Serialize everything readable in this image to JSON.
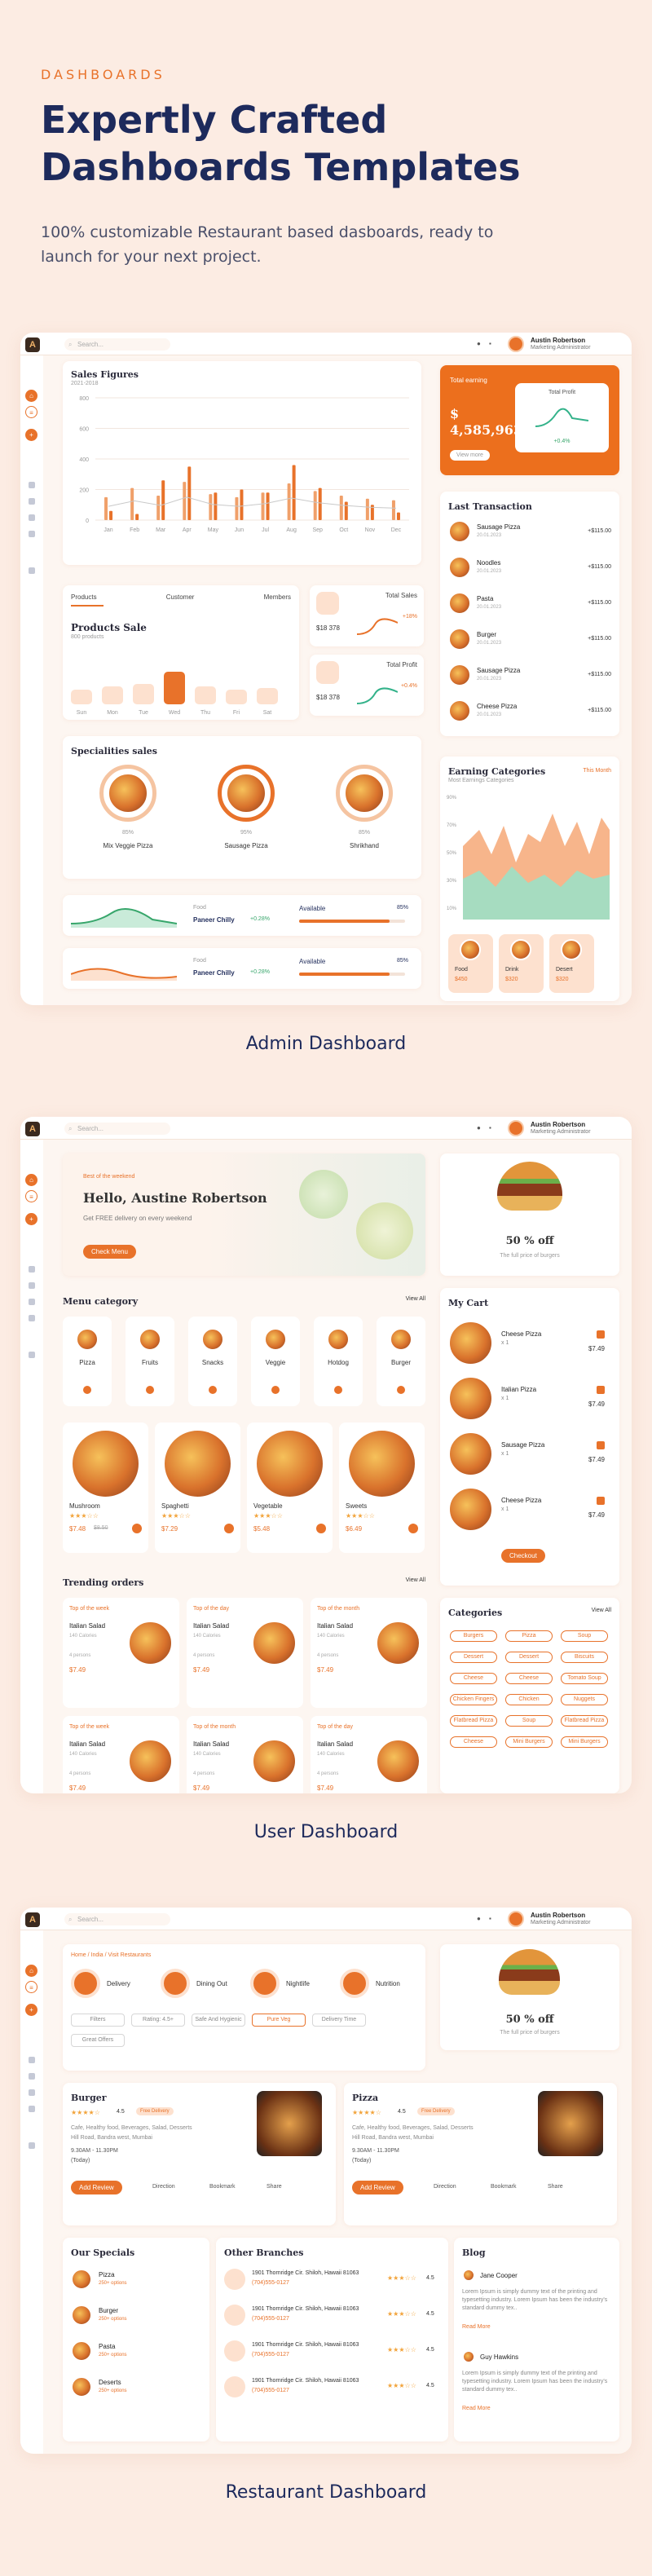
{
  "hero": {
    "kicker": "DASHBOARDS",
    "title_line1": "Expertly Crafted",
    "title_line2": "Dashboards Templates",
    "lead": "100% customizable Restaurant based dasboards, ready to launch for your next project."
  },
  "captions": {
    "admin": "Admin Dashboard",
    "user": "User Dashboard",
    "restaurant": "Restaurant Dashboard"
  },
  "common": {
    "search_placeholder": "Search...",
    "user_name": "Austin Robertson",
    "user_role": "Marketing Administrator"
  },
  "admin": {
    "sales_title": "Sales Figures",
    "sales_sub": "2021-2018",
    "chart_data": {
      "type": "bar",
      "categories": [
        "Jan",
        "Feb",
        "Mar",
        "Apr",
        "May",
        "Jun",
        "Jul",
        "Aug",
        "Sep",
        "Oct",
        "Nov",
        "Dec"
      ],
      "series": [
        {
          "values": [
            150,
            210,
            160,
            250,
            170,
            150,
            180,
            240,
            190,
            160,
            140,
            130
          ]
        },
        {
          "values": [
            60,
            40,
            260,
            350,
            180,
            200,
            180,
            360,
            210,
            120,
            100,
            50
          ]
        }
      ],
      "y_ticks": [
        "0",
        "200",
        "400",
        "600",
        "800"
      ],
      "ylim": [
        0,
        800
      ]
    },
    "total_earning": {
      "label": "Total earning",
      "value": "$ 4,585,963",
      "btn": "View more",
      "profit_label": "Total Profit",
      "profit_change": "+0.4%"
    },
    "tabs": [
      "Products",
      "Customer",
      "Members"
    ],
    "products_sale": {
      "title": "Products Sale",
      "sub": "800 products",
      "days": [
        "Sun",
        "Mon",
        "Tue",
        "Wed",
        "Thu",
        "Fri",
        "Sat"
      ],
      "values": [
        20,
        25,
        28,
        45,
        25,
        20,
        22
      ]
    },
    "total_sales": {
      "label": "Total Sales",
      "value": "$18 378",
      "change": "+18%"
    },
    "total_profit": {
      "label": "Total Profit",
      "value": "$18 378",
      "change": "+0.4%"
    },
    "specialities": {
      "title": "Specialities sales",
      "items": [
        {
          "pct": "85%",
          "name": "Mix Veggie Pizza"
        },
        {
          "pct": "95%",
          "name": "Sausage Pizza"
        },
        {
          "pct": "85%",
          "name": "Shrikhand"
        }
      ]
    },
    "food_rows": [
      {
        "label": "Food",
        "name": "Paneer Chilly",
        "change": "+0.28%",
        "avail": "Available",
        "pct": "85%"
      },
      {
        "label": "Food",
        "name": "Paneer Chilly",
        "change": "+0.28%",
        "avail": "Available",
        "pct": "85%"
      }
    ],
    "last_transaction": {
      "title": "Last Transaction",
      "items": [
        {
          "name": "Sausage Pizza",
          "date": "20.01.2023",
          "amount": "+$115.00"
        },
        {
          "name": "Noodles",
          "date": "20.01.2023",
          "amount": "+$115.00"
        },
        {
          "name": "Pasta",
          "date": "20.01.2023",
          "amount": "+$115.00"
        },
        {
          "name": "Burger",
          "date": "20.01.2023",
          "amount": "+$115.00"
        },
        {
          "name": "Sausage Pizza",
          "date": "20.01.2023",
          "amount": "+$115.00"
        },
        {
          "name": "Cheese Pizza",
          "date": "20.01.2023",
          "amount": "+$115.00"
        }
      ]
    },
    "earning_categories": {
      "title": "Earning Categories",
      "sub": "Most Earnings Categories",
      "filter": "This Month",
      "y_ticks": [
        "90%",
        "70%",
        "50%",
        "30%",
        "10%"
      ],
      "cats": [
        {
          "name": "Food",
          "value": "$450"
        },
        {
          "name": "Drink",
          "value": "$320"
        },
        {
          "name": "Desert",
          "value": "$320"
        }
      ]
    }
  },
  "user": {
    "banner": {
      "tag": "Best of the weekend",
      "title": "Hello, Austine Robertson",
      "sub": "Get FREE delivery on every weekend",
      "btn": "Check Menu"
    },
    "promo": {
      "title": "50 % off",
      "sub": "The full price of burgers"
    },
    "menu": {
      "title": "Menu category",
      "view": "View All",
      "items": [
        "Pizza",
        "Fruits",
        "Snacks",
        "Veggie",
        "Hotdog",
        "Burger"
      ]
    },
    "dishes": [
      {
        "name": "Mushroom",
        "price": "$7.48",
        "old": "$8.50"
      },
      {
        "name": "Spaghetti",
        "price": "$7.29"
      },
      {
        "name": "Vegetable",
        "price": "$5.48"
      },
      {
        "name": "Sweets",
        "price": "$6.49"
      }
    ],
    "cart": {
      "title": "My Cart",
      "items": [
        {
          "name": "Cheese Pizza",
          "qty": "x 1",
          "price": "$7.49"
        },
        {
          "name": "Italian Pizza",
          "qty": "x 1",
          "price": "$7.49"
        },
        {
          "name": "Sausage Pizza",
          "qty": "x 1",
          "price": "$7.49"
        },
        {
          "name": "Cheese Pizza",
          "qty": "x 1",
          "price": "$7.49"
        }
      ],
      "btn": "Checkout"
    },
    "trending": {
      "title": "Trending orders",
      "view": "View All",
      "items": [
        {
          "tag": "Top of the week",
          "name": "Italian Salad",
          "cal": "140 Calories",
          "persons": "4 persons",
          "price": "$7.49"
        },
        {
          "tag": "Top of the day",
          "name": "Italian Salad",
          "cal": "140 Calories",
          "persons": "4 persons",
          "price": "$7.49"
        },
        {
          "tag": "Top of the month",
          "name": "Italian Salad",
          "cal": "140 Calories",
          "persons": "4 persons",
          "price": "$7.49"
        },
        {
          "tag": "Top of the week",
          "name": "Italian Salad",
          "cal": "140 Calories",
          "persons": "4 persons",
          "price": "$7.49"
        },
        {
          "tag": "Top of the month",
          "name": "Italian Salad",
          "cal": "140 Calories",
          "persons": "4 persons",
          "price": "$7.49"
        },
        {
          "tag": "Top of the day",
          "name": "Italian Salad",
          "cal": "140 Calories",
          "persons": "4 persons",
          "price": "$7.49"
        }
      ]
    },
    "categories": {
      "title": "Categories",
      "view": "View All",
      "items": [
        "Burgers",
        "Pizza",
        "Soup",
        "Dessert",
        "Dessert",
        "Biscuits",
        "Cheese",
        "Cheese",
        "Tomato Soup",
        "Chicken Fingers",
        "Chicken",
        "Nuggets",
        "Flatbread Pizza",
        "Soup",
        "Flatbread Pizza",
        "Cheese",
        "Mini Burgers",
        "Mini Burgers"
      ]
    }
  },
  "restaurant": {
    "breadcrumb": "Home / India / Visit Restaurants",
    "services": [
      "Delivery",
      "Dining Out",
      "Nightlife",
      "Nutrition"
    ],
    "filters": [
      "Filters",
      "Rating: 4.5+",
      "Safe And Hygienic",
      "Pure Veg",
      "Delivery Time",
      "Great Offers"
    ],
    "promo": {
      "title": "50 % off",
      "sub": "The full price of burgers"
    },
    "places": [
      {
        "title": "Burger",
        "rating": "4.5",
        "badge": "Free Delivery",
        "desc": "Cafe, Healthy food, Beverages, Salad, Desserts",
        "addr": "Hill Road, Bandra west, Mumbai",
        "time": "9.30AM - 11.30PM",
        "day": "(Today)",
        "btn": "Add Review",
        "actions": [
          "Direction",
          "Bookmark",
          "Share"
        ]
      },
      {
        "title": "Pizza",
        "rating": "4.5",
        "badge": "Free Delivery",
        "desc": "Cafe, Healthy food, Beverages, Salad, Desserts",
        "addr": "Hill Road, Bandra west, Mumbai",
        "time": "9.30AM - 11.30PM",
        "day": "(Today)",
        "btn": "Add Review",
        "actions": [
          "Direction",
          "Bookmark",
          "Share"
        ]
      }
    ],
    "specials": {
      "title": "Our Specials",
      "items": [
        {
          "name": "Pizza",
          "opts": "250+ options"
        },
        {
          "name": "Burger",
          "opts": "250+ options"
        },
        {
          "name": "Pasta",
          "opts": "250+ options"
        },
        {
          "name": "Deserts",
          "opts": "250+ options"
        }
      ]
    },
    "branches": {
      "title": "Other Branches",
      "items": [
        {
          "addr": "1901 Thornridge Cir. Shiloh, Hawaii 81063",
          "phone": "(704)555-0127",
          "rating": "4.5"
        },
        {
          "addr": "1901 Thornridge Cir. Shiloh, Hawaii 81063",
          "phone": "(704)555-0127",
          "rating": "4.5"
        },
        {
          "addr": "1901 Thornridge Cir. Shiloh, Hawaii 81063",
          "phone": "(704)555-0127",
          "rating": "4.5"
        },
        {
          "addr": "1901 Thornridge Cir. Shiloh, Hawaii 81063",
          "phone": "(704)555-0127",
          "rating": "4.5"
        }
      ]
    },
    "blog": {
      "title": "Blog",
      "items": [
        {
          "author": "Jane Cooper",
          "text": "Lorem Ipsum is simply dummy text of the printing and typesetting industry. Lorem Ipsum has been the industry's standard dummy tex..",
          "more": "Read More"
        },
        {
          "author": "Guy Hawkins",
          "text": "Lorem Ipsum is simply dummy text of the printing and typesetting industry. Lorem Ipsum has been the industry's standard dummy tex..",
          "more": "Read More"
        }
      ]
    }
  }
}
